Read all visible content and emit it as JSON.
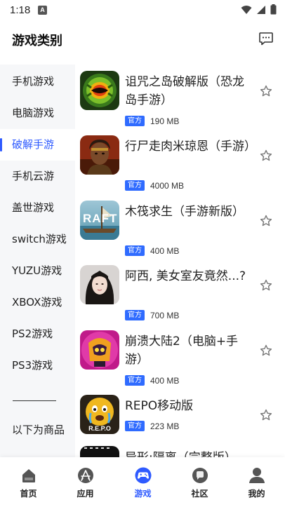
{
  "status_bar": {
    "time": "1:18",
    "notif_letter": "A"
  },
  "header": {
    "title": "游戏类别"
  },
  "sidebar": {
    "items": [
      {
        "label": "手机游戏"
      },
      {
        "label": "电脑游戏"
      },
      {
        "label": "破解手游",
        "active": true
      },
      {
        "label": "手机云游"
      },
      {
        "label": "盖世游戏"
      },
      {
        "label": "switch游戏"
      },
      {
        "label": "YUZU游戏"
      },
      {
        "label": "XBOX游戏"
      },
      {
        "label": "PS2游戏"
      },
      {
        "label": "PS3游戏"
      },
      {
        "label": "以下为商品"
      }
    ]
  },
  "games": [
    {
      "name": "诅咒之岛破解版（恐龙岛手游）",
      "badge": "官方",
      "size": "190 MB"
    },
    {
      "name": "行尸走肉米琼恩（手游）",
      "badge": "官方",
      "size": "4000 MB"
    },
    {
      "name": "木筏求生（手游新版）",
      "badge": "官方",
      "size": "400 MB",
      "icon_text": "RAFT"
    },
    {
      "name": "阿西, 美女室友竟然...?",
      "badge": "官方",
      "size": "700 MB"
    },
    {
      "name": "崩溃大陆2（电脑+手游）",
      "badge": "官方",
      "size": "400 MB"
    },
    {
      "name": "REPO移动版",
      "badge": "官方",
      "size": "223 MB",
      "icon_text": "R.E.P.O"
    },
    {
      "name": "异形:隔离（完整版）"
    }
  ],
  "bottom_nav": {
    "tabs": [
      {
        "label": "首页",
        "icon": "home-icon"
      },
      {
        "label": "应用",
        "icon": "app-store-icon"
      },
      {
        "label": "游戏",
        "icon": "gamepad-icon",
        "active": true
      },
      {
        "label": "社区",
        "icon": "chat-bubble-icon"
      },
      {
        "label": "我的",
        "icon": "profile-icon"
      }
    ]
  },
  "colors": {
    "accent": "#2f5bff",
    "badge": "#2f6bff",
    "sidebar_bg": "#f6f7f9"
  }
}
